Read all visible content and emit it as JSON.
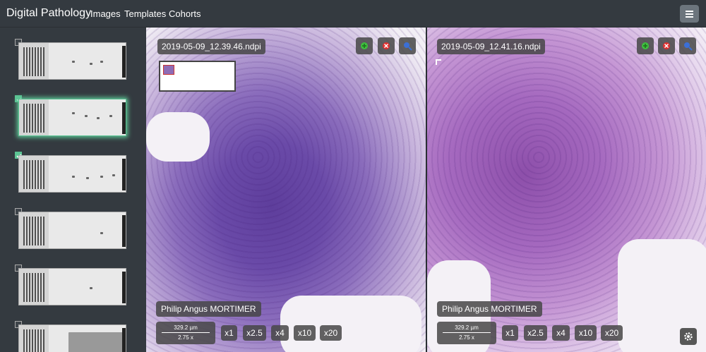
{
  "navbar": {
    "brand": "Digital Pathology",
    "links": [
      "Images",
      "Templates",
      "Cohorts"
    ]
  },
  "sidebar": {
    "slides": [
      {
        "checked": false,
        "selected": false
      },
      {
        "checked": true,
        "selected": true
      },
      {
        "checked": true,
        "selected": false
      },
      {
        "checked": false,
        "selected": false
      },
      {
        "checked": false,
        "selected": false
      },
      {
        "checked": false,
        "selected": false
      }
    ]
  },
  "viewers": [
    {
      "filename": "2019-05-09_12.39.46.ndpi",
      "patient": "Philip Angus MORTIMER",
      "scale_length": "329.2 µm",
      "scale_zoom": "2.75 x",
      "zoom_levels": [
        "x1",
        "x2.5",
        "x4",
        "x10",
        "x20"
      ]
    },
    {
      "filename": "2019-05-09_12.41.16.ndpi",
      "patient": "Philip Angus MORTIMER",
      "scale_length": "329.2 µm",
      "scale_zoom": "2.75 x",
      "zoom_levels": [
        "x1",
        "x2.5",
        "x4",
        "x10",
        "x20"
      ]
    }
  ],
  "icons": {
    "add": "add-annotation-icon",
    "remove": "remove-annotation-icon",
    "search": "zoom-search-icon",
    "menu": "hamburger-menu-icon",
    "settings": "gear-icon"
  },
  "colors": {
    "navbar": "#343a40",
    "selected": "#5cc494",
    "add": "#3fbf3f",
    "remove": "#e03030",
    "search": "#3b6fd6"
  }
}
